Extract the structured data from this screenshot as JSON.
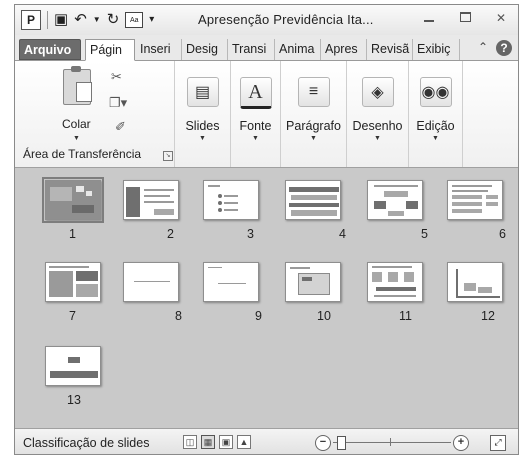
{
  "window": {
    "title": "Apresenção Previdência Ita...",
    "app_icon_letter": "P",
    "quick_access": [
      {
        "name": "save-icon",
        "glyph": "▣"
      },
      {
        "name": "undo-icon",
        "glyph": "↶"
      },
      {
        "name": "redo-icon",
        "glyph": "↻"
      },
      {
        "name": "customize-qat-icon",
        "glyph": "▾"
      }
    ],
    "controls": {
      "close": "✕"
    }
  },
  "tabs": [
    {
      "label": "Arquivo"
    },
    {
      "label": "Págin"
    },
    {
      "label": "Inseri"
    },
    {
      "label": "Desig"
    },
    {
      "label": "Transi"
    },
    {
      "label": "Anima"
    },
    {
      "label": "Apres"
    },
    {
      "label": "Revisã"
    },
    {
      "label": "Exibiç"
    }
  ],
  "help_label": "?",
  "ribbon": {
    "clipboard": {
      "paste_label": "Colar",
      "group_label": "Área de Transferência"
    },
    "buttons": [
      {
        "label": "Slides",
        "glyph": "▤"
      },
      {
        "label": "Fonte",
        "glyph": "A"
      },
      {
        "label": "Parágrafo",
        "glyph": "≡"
      },
      {
        "label": "Desenho",
        "glyph": "◈"
      },
      {
        "label": "Edição",
        "glyph": "🔭"
      }
    ]
  },
  "slides": [
    {
      "num": "1",
      "selected": true
    },
    {
      "num": "2"
    },
    {
      "num": "3"
    },
    {
      "num": "4"
    },
    {
      "num": "5"
    },
    {
      "num": "6"
    },
    {
      "num": "7"
    },
    {
      "num": "8"
    },
    {
      "num": "9"
    },
    {
      "num": "10"
    },
    {
      "num": "11"
    },
    {
      "num": "12"
    },
    {
      "num": "13"
    }
  ],
  "status": {
    "view_label": "Classificação de slides",
    "zoom_minus": "−",
    "zoom_plus": "+"
  },
  "colors": {
    "file_tab": "#6c6c6c",
    "sorter_bg": "#c9c9c9"
  }
}
